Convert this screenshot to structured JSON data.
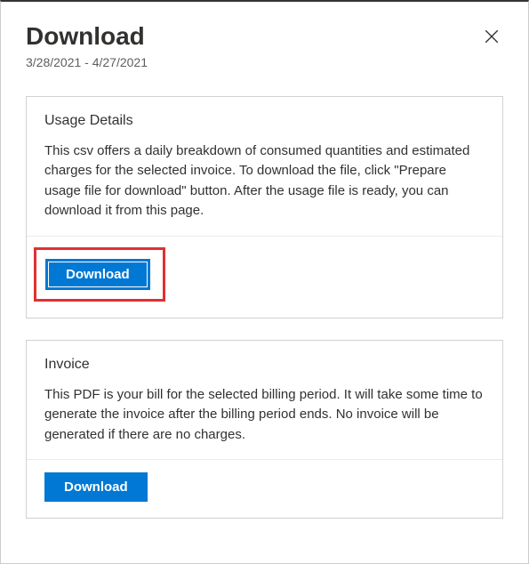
{
  "header": {
    "title": "Download",
    "date_range": "3/28/2021 - 4/27/2021"
  },
  "cards": {
    "usage": {
      "title": "Usage Details",
      "description": "This csv offers a daily breakdown of consumed quantities and estimated charges for the selected invoice. To download the file, click \"Prepare usage file for download\" button. After the usage file is ready, you can download it from this page.",
      "button_label": "Download"
    },
    "invoice": {
      "title": "Invoice",
      "description": "This PDF is your bill for the selected billing period. It will take some time to generate the invoice after the billing period ends. No invoice will be generated if there are no charges.",
      "button_label": "Download"
    }
  },
  "colors": {
    "primary": "#0078d4",
    "highlight": "#e03030"
  }
}
